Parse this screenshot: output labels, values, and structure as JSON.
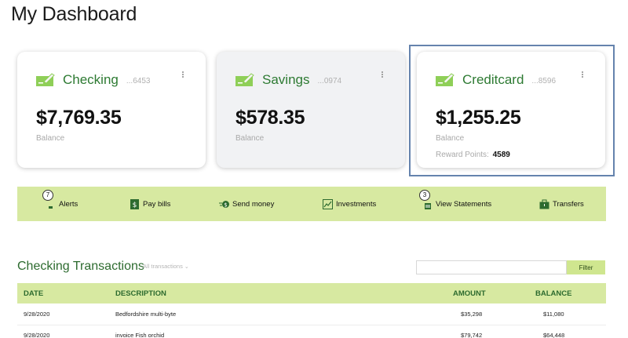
{
  "page": {
    "title": "My Dashboard"
  },
  "accounts": [
    {
      "name": "Checking",
      "number": "...6453",
      "balance": "$7,769.35",
      "balance_label": "Balance"
    },
    {
      "name": "Savings",
      "number": "...0974",
      "balance": "$578.35",
      "balance_label": "Balance"
    },
    {
      "name": "Creditcard",
      "number": "...8596",
      "balance": "$1,255.25",
      "balance_label": "Balance",
      "reward_label": "Reward Points:",
      "reward_points": "4589"
    }
  ],
  "actions": [
    {
      "label": "Alerts",
      "icon": "alert-icon",
      "badge": "7"
    },
    {
      "label": "Pay bills",
      "icon": "dollar-bill-icon"
    },
    {
      "label": "Send money",
      "icon": "send-money-icon"
    },
    {
      "label": "Investments",
      "icon": "chart-icon"
    },
    {
      "label": "View Statements",
      "icon": "statement-icon",
      "badge": "3"
    },
    {
      "label": "Transfers",
      "icon": "briefcase-icon"
    }
  ],
  "transactions": {
    "title": "Checking Transactions",
    "filter_selected": "All transactions",
    "search_placeholder": "",
    "filter_button": "Filter",
    "columns": [
      "DATE",
      "DESCRIPTION",
      "AMOUNT",
      "BALANCE"
    ],
    "rows": [
      {
        "date": "9/28/2020",
        "description": "Bedfordshire multi-byte",
        "amount": "$35,298",
        "balance": "$11,080"
      },
      {
        "date": "9/28/2020",
        "description": "invoice Fish orchid",
        "amount": "$79,742",
        "balance": "$64,448"
      }
    ]
  },
  "colors": {
    "accent_green": "#2d7a32",
    "bar_green": "#d7e9a1",
    "selection_blue": "#6583ad"
  }
}
